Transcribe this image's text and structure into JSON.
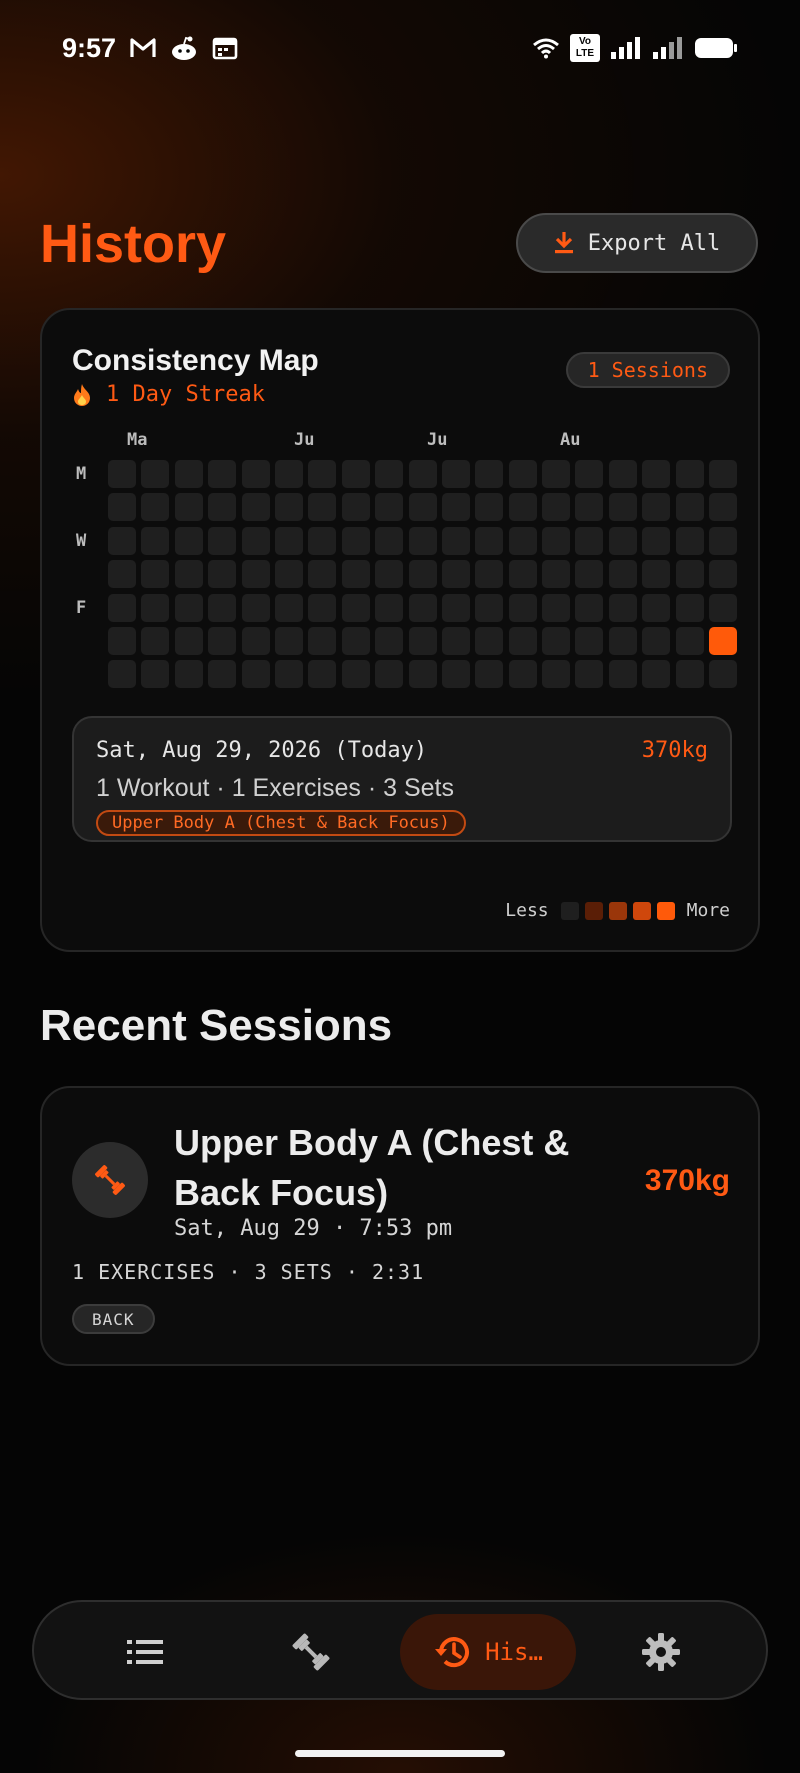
{
  "status_bar": {
    "time": "9:57",
    "left_icons": [
      "gmail-icon",
      "reddit-icon",
      "calendar-icon"
    ],
    "right_icons": [
      "wifi-icon",
      "volte-icon",
      "signal-1-icon",
      "signal-2-icon",
      "battery-icon"
    ],
    "volte_text": "Vo LTE"
  },
  "header": {
    "title": "History",
    "export_label": "Export All"
  },
  "consistency": {
    "title": "Consistency Map",
    "streak_label": "1 Day Streak",
    "sessions_badge": "1 Sessions",
    "month_labels": [
      "Ma",
      "Ju",
      "Ju",
      "Au"
    ],
    "day_labels": [
      "M",
      "W",
      "F"
    ],
    "weeks": 19,
    "days_per_week": 7,
    "active_cells": [
      {
        "week": 18,
        "day": 5,
        "level": 4
      }
    ],
    "detail": {
      "date": "Sat, Aug 29, 2026 (Today)",
      "weight": "370kg",
      "summary": "1 Workout · 1 Exercises · 3 Sets",
      "tag": "Upper Body A (Chest & Back Focus)"
    },
    "legend": {
      "less": "Less",
      "more": "More",
      "colors": [
        "#1f1f1f",
        "#5a1e06",
        "#9a360a",
        "#cf470c",
        "#ff5a0a"
      ]
    }
  },
  "recent": {
    "title": "Recent Sessions",
    "sessions": [
      {
        "name": "Upper Body A (Chest & Back Focus)",
        "weight": "370kg",
        "date": "Sat, Aug 29 · 7:53 pm",
        "stats": "1 EXERCISES · 3 SETS · 2:31",
        "tag": "BACK"
      }
    ]
  },
  "nav": {
    "items": [
      {
        "icon": "list-icon",
        "label": ""
      },
      {
        "icon": "dumbbell-icon",
        "label": ""
      },
      {
        "icon": "history-icon",
        "label": "His…",
        "active": true
      },
      {
        "icon": "gear-icon",
        "label": ""
      }
    ]
  },
  "colors": {
    "accent": "#ff5a14",
    "background": "#050505",
    "card": "#0c0c0c"
  }
}
